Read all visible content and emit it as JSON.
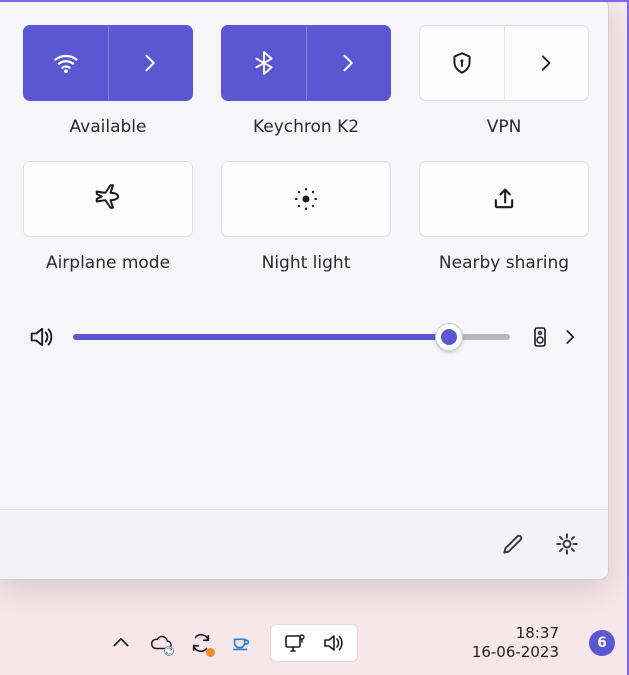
{
  "tiles": {
    "wifi": {
      "label": "Available",
      "active": true,
      "split": true
    },
    "bt": {
      "label": "Keychron K2",
      "active": true,
      "split": true
    },
    "vpn": {
      "label": "VPN",
      "active": false,
      "split": true
    },
    "air": {
      "label": "Airplane mode",
      "active": false,
      "split": false
    },
    "night": {
      "label": "Night light",
      "active": false,
      "split": false
    },
    "share": {
      "label": "Nearby sharing",
      "active": false,
      "split": false
    }
  },
  "volume": {
    "percent": 86
  },
  "taskbar": {
    "time": "18:37",
    "date": "16-06-2023",
    "notification_count": "6"
  },
  "colors": {
    "accent": "#5b57d2"
  }
}
